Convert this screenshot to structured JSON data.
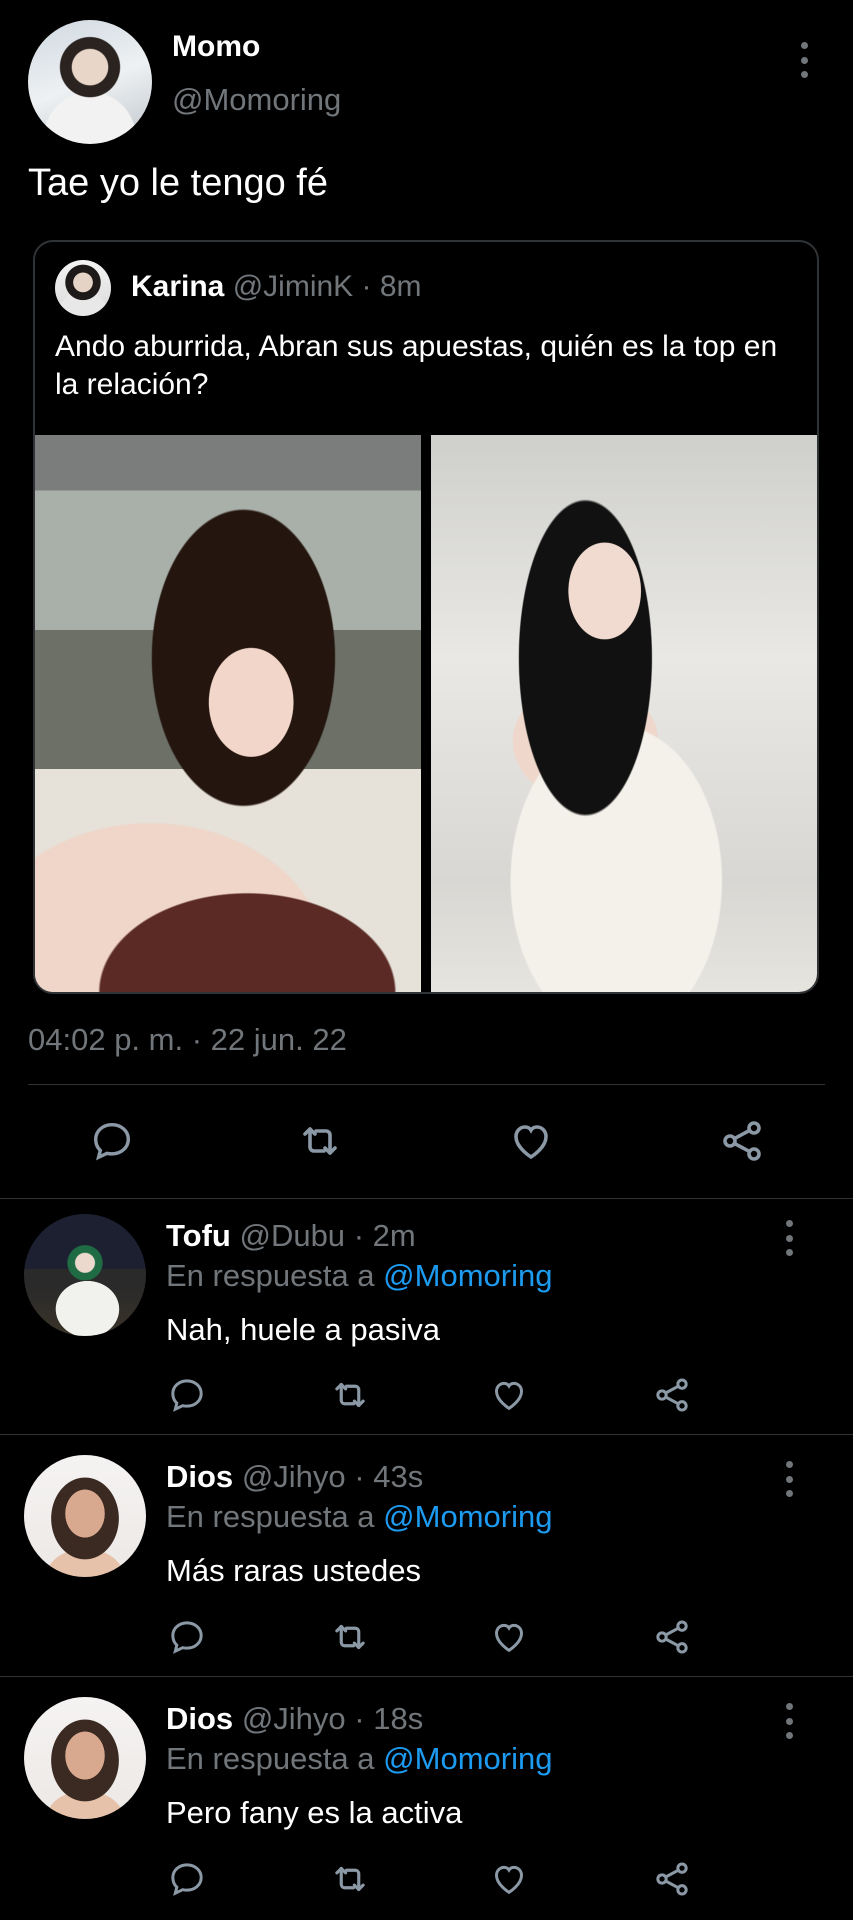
{
  "tweet": {
    "author_name": "Momo",
    "author_handle": "@Momoring",
    "text": "Tae yo le tengo fé",
    "timestamp": "04:02 p. m. · 22 jun. 22",
    "quote": {
      "author_name": "Karina",
      "author_handle": "@JiminK",
      "separator": "·",
      "time": "8m",
      "text": "Ando aburrida, Abran sus apuestas, quién es la top en la relación?"
    }
  },
  "icons": {
    "reply": "speech-bubble-icon",
    "retweet": "retweet-icon",
    "like": "heart-icon",
    "share": "share-icon",
    "more": "kebab-icon"
  },
  "colors": {
    "background": "#000000",
    "text": "#e7e9ea",
    "muted": "#71767b",
    "accent": "#1d9bf0",
    "border": "#2f3336"
  },
  "replies": [
    {
      "name": "Tofu",
      "handle": "@Dubu",
      "meta": "· 2m",
      "replying_prefix": "En respuesta a",
      "replying_mention": "@Momoring",
      "text": "Nah, huele a pasiva"
    },
    {
      "name": "Dios",
      "handle": "@Jihyo",
      "meta": "· 43s",
      "replying_prefix": "En respuesta a",
      "replying_mention": "@Momoring",
      "text": "Más raras ustedes"
    },
    {
      "name": "Dios",
      "handle": "@Jihyo",
      "meta": "· 18s",
      "replying_prefix": "En respuesta a",
      "replying_mention": "@Momoring",
      "text": "Pero fany es la activa"
    }
  ]
}
